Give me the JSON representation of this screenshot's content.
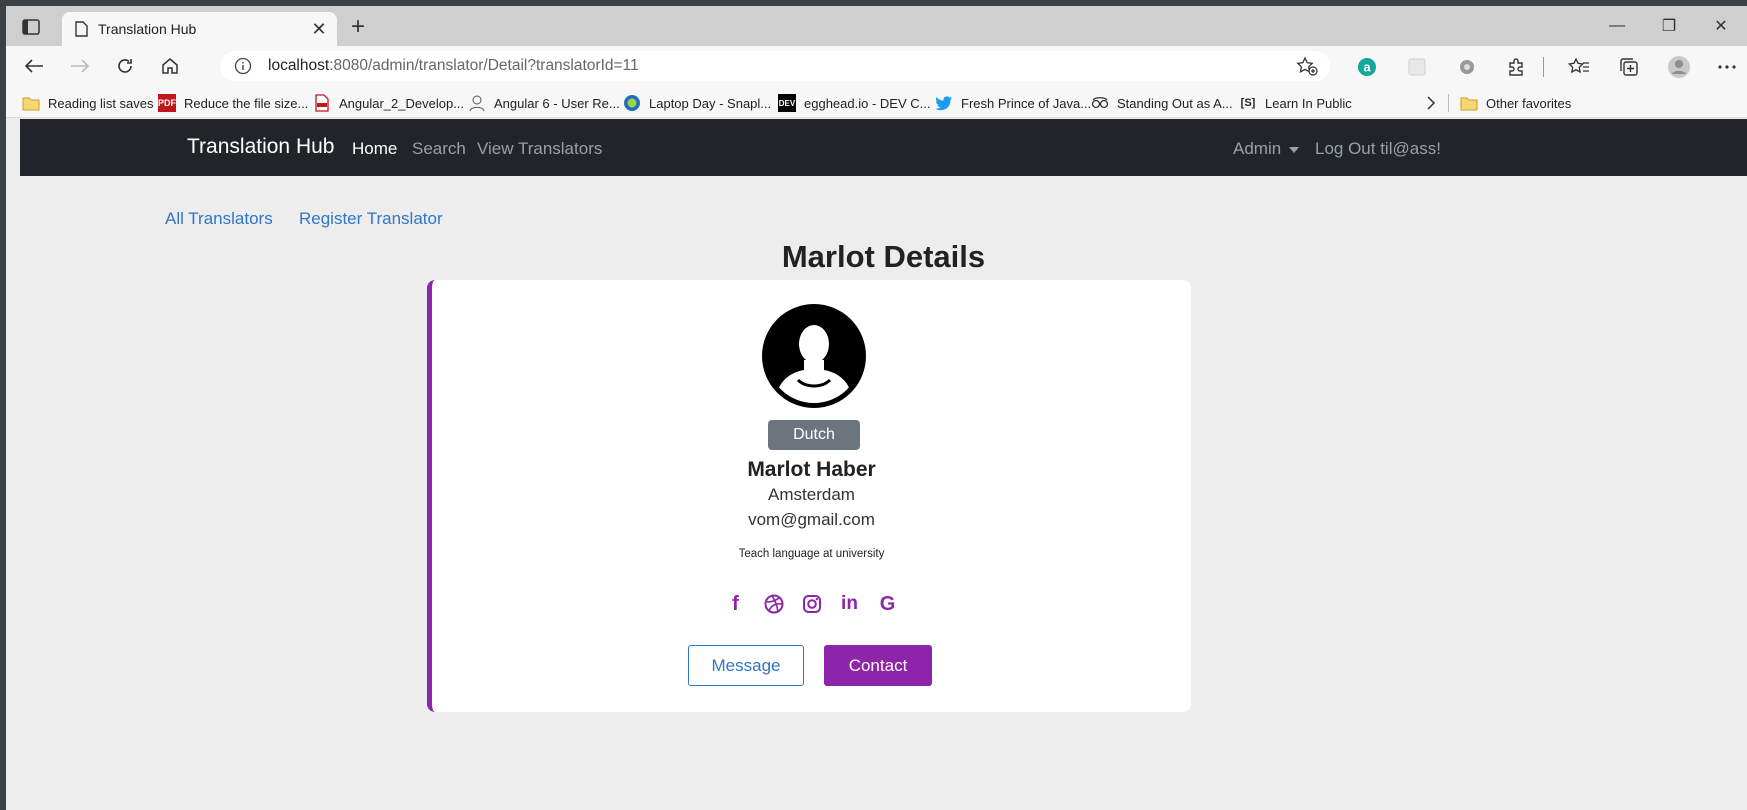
{
  "browser": {
    "tab_title": "Translation Hub",
    "url_host": "localhost",
    "url_rest": ":8080/admin/translator/Detail?translatorId=11",
    "bookmarks": [
      "Reading list saves",
      "Reduce the file size...",
      "Angular_2_Develop...",
      "Angular 6 - User Re...",
      "Laptop Day - Snapl...",
      "egghead.io - DEV C...",
      "Fresh Prince of Java...",
      "Standing Out as A...",
      "Learn In Public"
    ],
    "other_favorites": "Other favorites",
    "bookmark_icons": {
      "pdf": "PDF",
      "dev": "DEV",
      "s": "[S]"
    }
  },
  "navbar": {
    "brand": "Translation Hub",
    "links": [
      "Home",
      "Search",
      "View Translators"
    ],
    "admin": "Admin",
    "logout": "Log Out til@ass!"
  },
  "subnav": {
    "all_translators": "All Translators",
    "register_translator": "Register Translator"
  },
  "page_title": "Marlot Details",
  "translator": {
    "language": "Dutch",
    "name": "Marlot Haber",
    "city": "Amsterdam",
    "email": "vom@gmail.com",
    "description": "Teach language at university"
  },
  "socials": [
    "facebook-icon",
    "dribbble-icon",
    "instagram-icon",
    "linkedin-icon",
    "google-icon"
  ],
  "social_glyphs": {
    "facebook": "f",
    "linkedin": "in",
    "google": "G"
  },
  "buttons": {
    "message": "Message",
    "contact": "Contact"
  },
  "colors": {
    "accent": "#8e24aa",
    "link": "#2f75c8",
    "navbar": "#212529",
    "badge": "#6c757d"
  }
}
